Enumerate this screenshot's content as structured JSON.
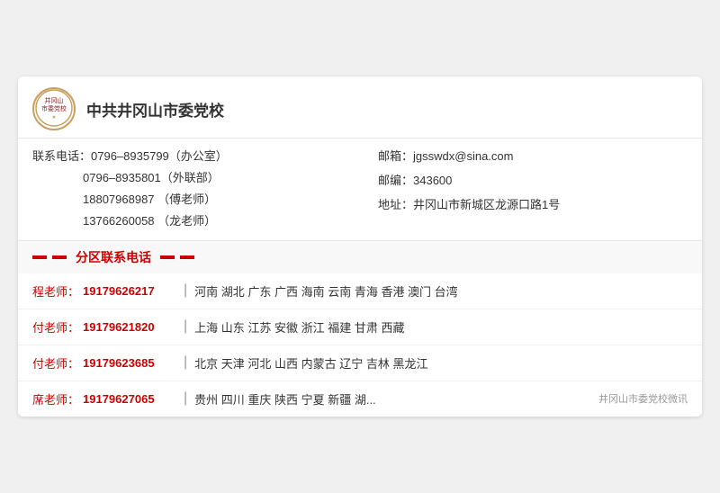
{
  "org": {
    "name": "中共井冈山市委党校",
    "logo_text": "井冈山\n市委党校"
  },
  "contact": {
    "label_phone": "联系电话：",
    "phone1": "0796–8935799（办公室）",
    "phone2": "0796–8935801（外联部）",
    "phone3": "18807968987  （傅老师）",
    "phone4": "13766260058  （龙老师）",
    "label_email": "邮箱：",
    "email": "jgsswdx@sina.com",
    "label_zip": "邮编：",
    "zip": "343600",
    "label_address": "地址：",
    "address": "井冈山市新城区龙源口路1号"
  },
  "section_title": "分区联系电话",
  "districts": [
    {
      "teacher": "程老师：",
      "phone": "19179626217",
      "regions": "河南  湖北  广东  广西  海南  云南  青海  香港  澳门  台湾"
    },
    {
      "teacher": "付老师：",
      "phone": "19179621820",
      "regions": "上海  山东  江苏  安徽  浙江  福建  甘肃  西藏"
    },
    {
      "teacher": "付老师：",
      "phone": "19179623685",
      "regions": "北京  天津  河北  山西  内蒙古  辽宁  吉林  黑龙江"
    },
    {
      "teacher": "席老师：",
      "phone": "19179627065",
      "regions": "贵州  四川  重庆  陕西  宁夏  新疆  湖..."
    }
  ],
  "watermark": "井冈山市委党校微讯"
}
